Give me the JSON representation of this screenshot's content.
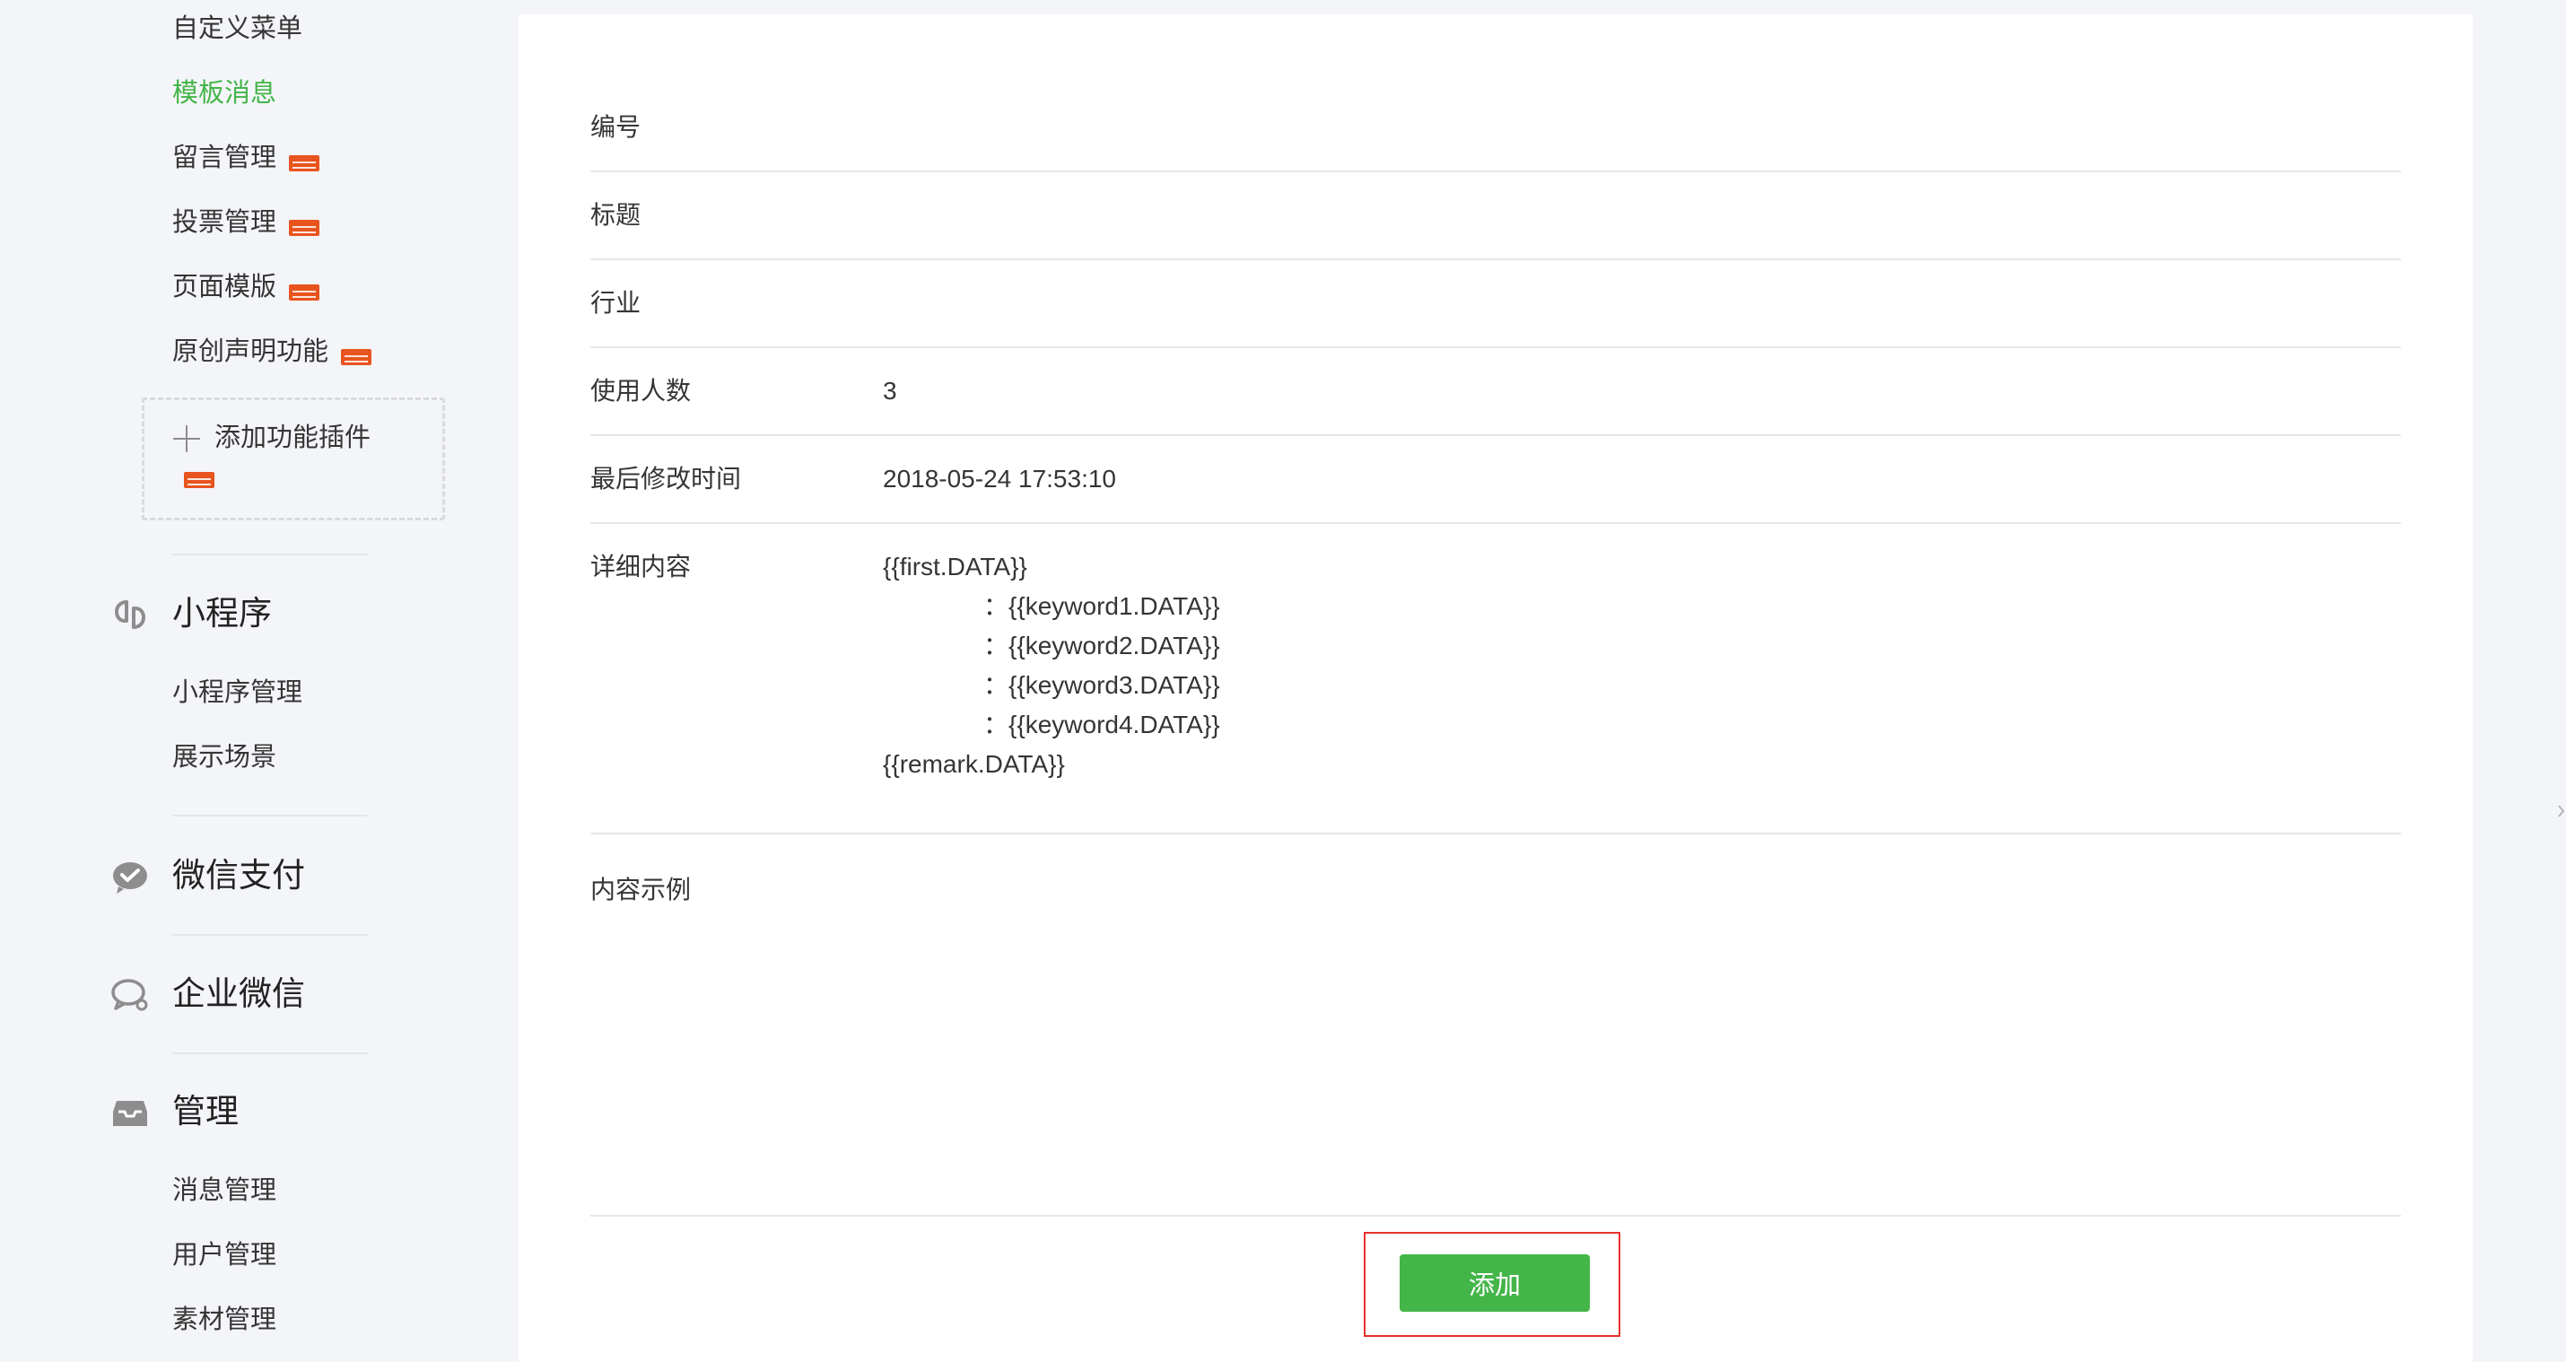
{
  "sidebar": {
    "items_top": [
      {
        "label": "自定义菜单",
        "new": false,
        "active": false
      },
      {
        "label": "模板消息",
        "new": false,
        "active": true
      },
      {
        "label": "留言管理",
        "new": true,
        "active": false
      },
      {
        "label": "投票管理",
        "new": true,
        "active": false
      },
      {
        "label": "页面模版",
        "new": true,
        "active": false
      },
      {
        "label": "原创声明功能",
        "new": true,
        "active": false
      }
    ],
    "add_plugin_label": "添加功能插件",
    "groups": {
      "mini_program": {
        "title": "小程序",
        "icon": "link-icon",
        "items": [
          "小程序管理",
          "展示场景"
        ]
      },
      "wechat_pay": {
        "title": "微信支付",
        "icon": "wechat-pay-icon"
      },
      "enterprise_wechat": {
        "title": "企业微信",
        "icon": "chat-bubble-icon"
      },
      "manage": {
        "title": "管理",
        "icon": "inbox-icon",
        "items": [
          "消息管理",
          "用户管理",
          "素材管理"
        ]
      }
    }
  },
  "detail": {
    "id_label": "编号",
    "id_value": "",
    "title_label": "标题",
    "title_value": "",
    "industry_label": "行业",
    "industry_value": "",
    "users_label": "使用人数",
    "users_value": "3",
    "modified_label": "最后修改时间",
    "modified_value": "2018-05-24 17:53:10",
    "content_label": "详细内容",
    "content_lines": [
      "{{first.DATA}}",
      "：{{keyword1.DATA}}",
      "：{{keyword2.DATA}}",
      "：{{keyword3.DATA}}",
      "：{{keyword4.DATA}}",
      "{{remark.DATA}}"
    ],
    "example_label": "内容示例",
    "example_value": ""
  },
  "actions": {
    "add_label": "添加"
  },
  "colors": {
    "accent": "#44b549",
    "new_badge": "#e8541e",
    "highlight": "#e8302f"
  }
}
